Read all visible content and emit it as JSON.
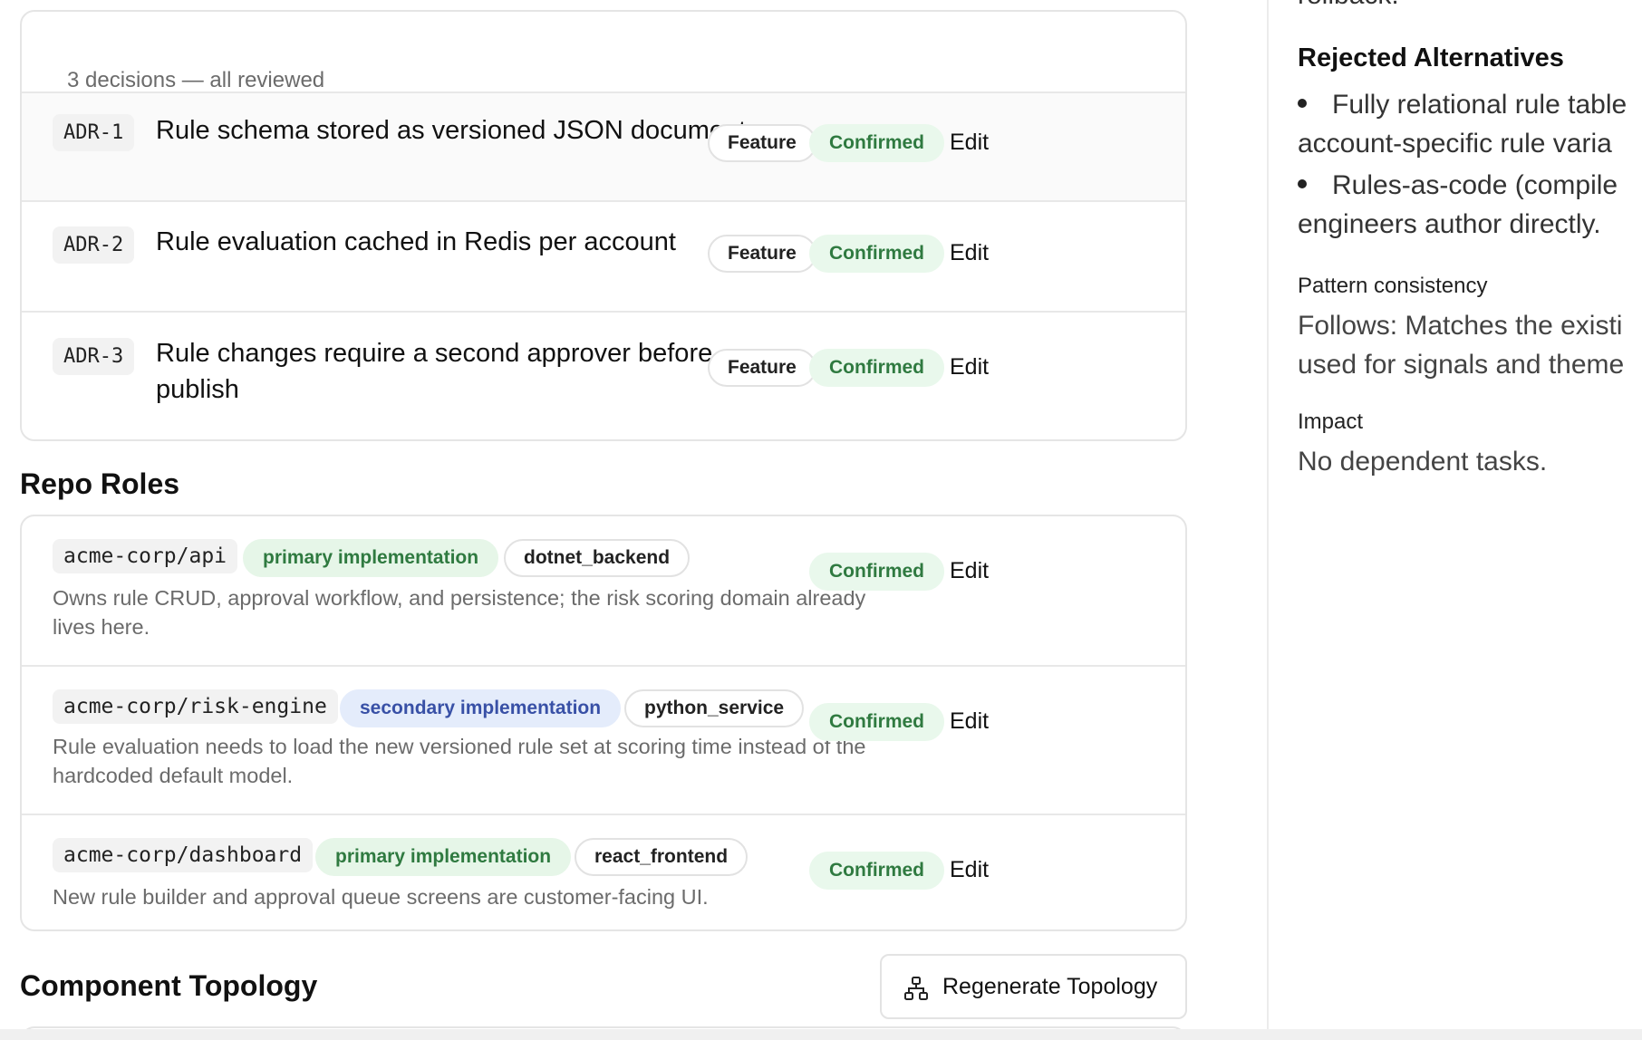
{
  "decisions": {
    "summary": "3 decisions — all reviewed",
    "items": [
      {
        "id": "ADR-1",
        "title": "Rule schema stored as versioned JSON documents",
        "type": "Feature",
        "status": "Confirmed",
        "edit": "Edit"
      },
      {
        "id": "ADR-2",
        "title": "Rule evaluation cached in Redis per account",
        "type": "Feature",
        "status": "Confirmed",
        "edit": "Edit"
      },
      {
        "id": "ADR-3",
        "title": "Rule changes require a second approver before publish",
        "type": "Feature",
        "status": "Confirmed",
        "edit": "Edit"
      }
    ]
  },
  "repo_roles": {
    "heading": "Repo Roles",
    "items": [
      {
        "repo": "acme-corp/api",
        "role": "primary implementation",
        "stack": "dotnet_backend",
        "status": "Confirmed",
        "edit": "Edit",
        "description": "Owns rule CRUD, approval workflow, and persistence; the risk scoring domain already lives here."
      },
      {
        "repo": "acme-corp/risk-engine",
        "role": "secondary implementation",
        "stack": "python_service",
        "status": "Confirmed",
        "edit": "Edit",
        "description": "Rule evaluation needs to load the new versioned rule set at scoring time instead of the hardcoded default model."
      },
      {
        "repo": "acme-corp/dashboard",
        "role": "primary implementation",
        "stack": "react_frontend",
        "status": "Confirmed",
        "edit": "Edit",
        "description": "New rule builder and approval queue screens are customer-facing UI."
      }
    ]
  },
  "topology": {
    "heading": "Component Topology",
    "regenerate_label": "Regenerate Topology"
  },
  "detail_panel": {
    "clipped_top_text": "rollback.",
    "rejected_heading": "Rejected Alternatives",
    "rejected_items": [
      {
        "line1": "Fully relational rule table",
        "line2": "account-specific rule varia"
      },
      {
        "line1": "Rules-as-code (compile",
        "line2": "engineers author directly."
      }
    ],
    "pattern_label": "Pattern consistency",
    "pattern_line1": "Follows: Matches the existi",
    "pattern_line2": "used for signals and theme",
    "impact_label": "Impact",
    "impact_text": "No dependent tasks."
  }
}
